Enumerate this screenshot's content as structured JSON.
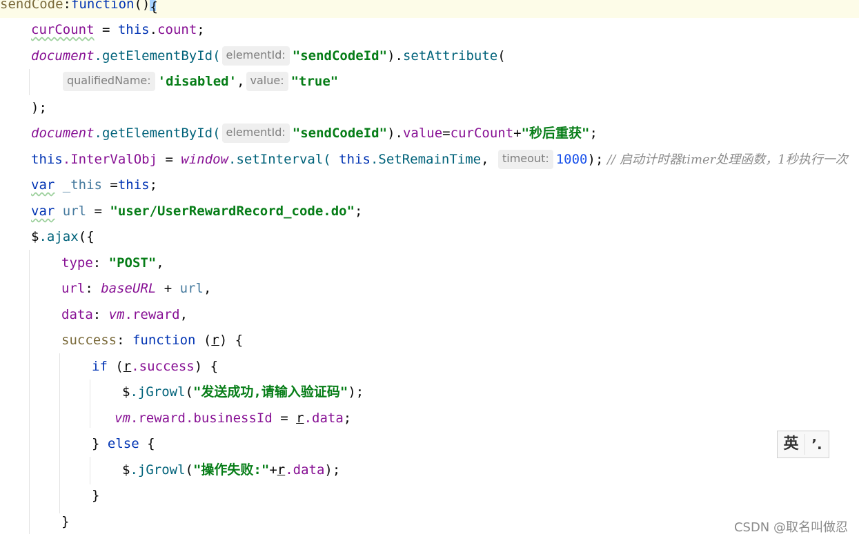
{
  "code": {
    "l1": {
      "fn_name": "sendCode",
      "colon": ":",
      "kw_function": "function",
      "parens": "()",
      "brace": "{"
    },
    "l2": {
      "var": "curCount",
      "eq": " = ",
      "kw_this": "this",
      "dot": ".",
      "prop": "count",
      "semi": ";"
    },
    "l3": {
      "obj": "document",
      "method": ".getElementById(",
      "hint": "elementId:",
      "arg": "\"sendCodeId\"",
      "close": ").",
      "method2": "setAttribute",
      "open": "("
    },
    "l4": {
      "hint1": "qualifiedName:",
      "arg1": "'disabled'",
      "comma": ",",
      "hint2": "value:",
      "arg2": "\"true\""
    },
    "l5": {
      "text": ");"
    },
    "l6": {
      "obj": "document",
      "method": ".getElementById(",
      "hint": "elementId:",
      "arg": "\"sendCodeId\"",
      "close": ").",
      "prop": "value",
      "eq": "=",
      "var": "curCount",
      "plus": "+",
      "str": "\"秒后重获\"",
      "semi": ";"
    },
    "l7": {
      "kw_this": "this",
      "prop": ".InterValObj",
      "eq": " = ",
      "obj": "window",
      "method": ".setInterval(",
      "kw_this2": " this",
      "method2": ".SetRemainTime",
      "comma": ", ",
      "hint": "timeout:",
      "num": "1000",
      "close": ");",
      "comment": " // 启动计时器timer处理函数，1秒执行一次"
    },
    "l8": {
      "kw_var": "var",
      "name": " _this",
      "eq": " =",
      "kw_this": "this",
      "semi": ";"
    },
    "l9": {
      "kw_var": "var",
      "name": " url",
      "eq": " = ",
      "str": "\"user/UserRewardRecord_code.do\"",
      "semi": ";"
    },
    "l10": {
      "dollar": "$",
      "method": ".ajax",
      "open": "({"
    },
    "l11": {
      "prop": "type",
      "colon": ": ",
      "str": "\"POST\"",
      "comma": ","
    },
    "l12": {
      "prop": "url",
      "colon": ": ",
      "var": "baseURL",
      "plus": " + ",
      "var2": "url",
      "comma": ","
    },
    "l13": {
      "prop": "data",
      "colon": ": ",
      "obj": "vm",
      "prop2": ".reward",
      "comma": ","
    },
    "l14": {
      "prop": "success",
      "colon": ": ",
      "kw_function": "function",
      "open": " (",
      "param": "r",
      "close": ") {"
    },
    "l15": {
      "kw_if": "if",
      "open": " (",
      "param": "r",
      "prop": ".success",
      "close": ") {"
    },
    "l16": {
      "dollar": "$",
      "method": ".jGrowl",
      "open": "(",
      "str": "\"发送成功,请输入验证码\"",
      "close": ");"
    },
    "l17": {
      "obj": "vm",
      "prop": ".reward.businessId",
      "eq": " = ",
      "param": "r",
      "prop2": ".data",
      "semi": ";"
    },
    "l18": {
      "open": "} ",
      "kw_else": "else",
      "brace": " {"
    },
    "l19": {
      "dollar": "$",
      "method": ".jGrowl",
      "open": "(",
      "str": "\"操作失败:\"",
      "plus": "+",
      "param": "r",
      "prop": ".data",
      "close": ");"
    },
    "l20": {
      "text": "}"
    },
    "l21": {
      "text": "}"
    }
  },
  "ime": {
    "language": "英",
    "punctuation": "’."
  },
  "watermark": "CSDN @取名叫做忍"
}
